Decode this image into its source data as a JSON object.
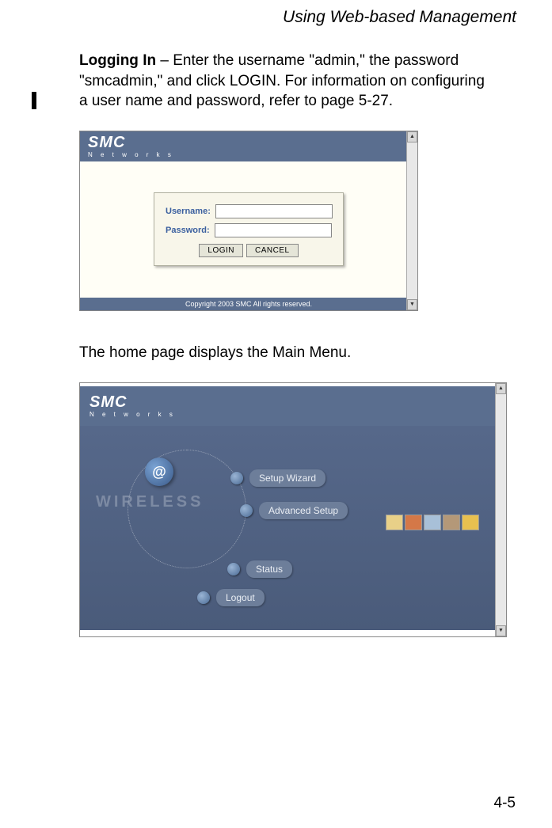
{
  "header": {
    "title": "Using Web-based Management"
  },
  "para1": {
    "bold": "Logging In",
    "rest": " – Enter the username \"admin,\" the password \"smcadmin,\" and click LOGIN. For information on configuring a user name and password, refer to page 5-27."
  },
  "login_screenshot": {
    "logo": "SMC",
    "logo_sub": "N e t w o r k s",
    "username_label": "Username:",
    "password_label": "Password:",
    "login_btn": "LOGIN",
    "cancel_btn": "CANCEL",
    "copyright": "Copyright 2003 SMC All rights reserved."
  },
  "para2": "The home page displays the Main Menu.",
  "menu_screenshot": {
    "logo": "SMC",
    "logo_sub": "N e t w o r k s",
    "wireless_text": "WIRELESS",
    "at_symbol": "@",
    "items": [
      "Setup Wizard",
      "Advanced Setup",
      "Status",
      "Logout"
    ]
  },
  "page_number": "4-5"
}
